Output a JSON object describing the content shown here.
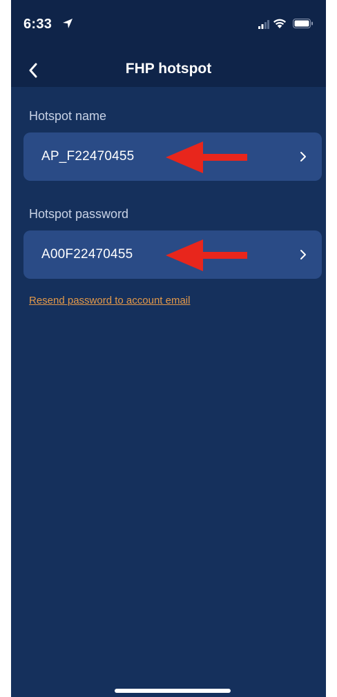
{
  "status_bar": {
    "time": "6:33"
  },
  "header": {
    "title": "FHP hotspot"
  },
  "hotspot_name": {
    "label": "Hotspot name",
    "value": "AP_F22470455"
  },
  "hotspot_password": {
    "label": "Hotspot password",
    "value": "A00F22470455"
  },
  "resend_link": {
    "label": "Resend password to account email"
  },
  "colors": {
    "background": "#15305c",
    "header_background": "#0f2449",
    "card": "#2a4b86",
    "link": "#e3994a",
    "annotation_arrow": "#e8261c"
  },
  "icons": {
    "back": "chevron-left-icon",
    "row_chevron": "chevron-right-icon",
    "location": "location-arrow-icon",
    "signal": "cellular-signal-icon",
    "wifi": "wifi-icon",
    "battery": "battery-icon",
    "annotation": "red-arrow-icon"
  }
}
